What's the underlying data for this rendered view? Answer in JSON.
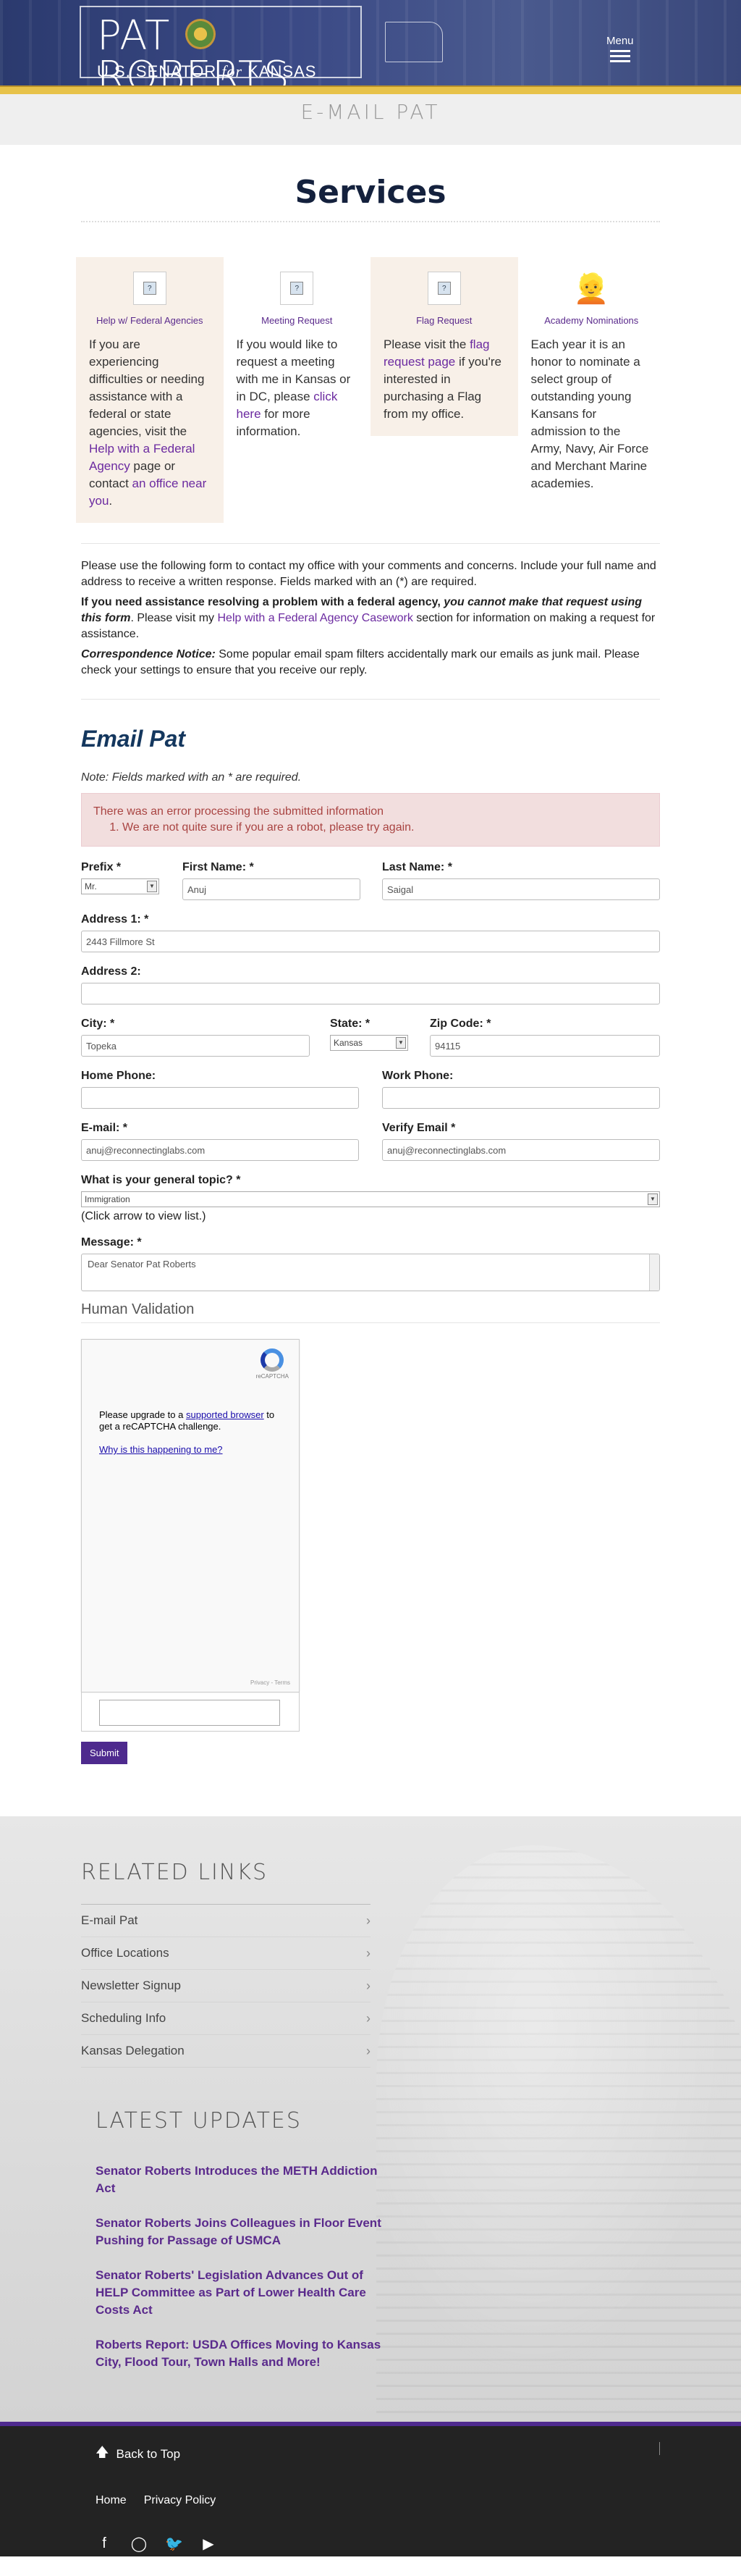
{
  "header": {
    "logo_name_left": "PAT",
    "logo_name_right": "ROBERTS",
    "logo_sub_left": "U.S. SENATOR",
    "logo_sub_for": "for",
    "logo_sub_right": "KANSAS",
    "menu_label": "Menu"
  },
  "page_heading": "E-MAIL PAT",
  "services": {
    "title": "Services",
    "cards": [
      {
        "title": "Help w/ Federal Agencies",
        "icon": "document-icon",
        "text_a": "If you are experiencing difficulties or needing assistance with a federal or state agencies, visit the ",
        "link_a": "Help with a Federal Agency",
        "text_b": " page or contact ",
        "link_b": "an office near you",
        "text_c": "."
      },
      {
        "title": "Meeting Request",
        "icon": "document-icon",
        "text_a": "If you would like to request a meeting with me in Kansas or in DC, please ",
        "link_a": "click here",
        "text_b": " for more information."
      },
      {
        "title": "Flag Request",
        "icon": "document-icon",
        "text_a": "Please visit the ",
        "link_a": "flag request page",
        "text_b": " if you're interested in purchasing a Flag from my office."
      },
      {
        "title": "Academy Nominations",
        "icon": "cadet-icon",
        "text_a": "Each year it is an honor to nominate a select group of outstanding young Kansans for admission to the Army, Navy, Air Force and Merchant Marine academies."
      }
    ]
  },
  "intro": {
    "p1": "Please use the following form to contact my office with your comments and concerns. Include your full name and address to receive a written response. Fields marked with an (*) are required.",
    "p2_bold": "If you need assistance resolving a problem with a federal agency, ",
    "p2_bold_italic": "you cannot make that request using this form",
    "p2_text": ". Please visit my ",
    "p2_link": "Help with a Federal Agency Casework",
    "p2_tail": " section for information on making a request for assistance.",
    "p3_label": "Correspondence Notice:",
    "p3_text": " Some popular email spam filters accidentally mark our emails as junk mail. Please check your settings to ensure that you receive our reply."
  },
  "form": {
    "title": "Email Pat",
    "note": "Note: Fields marked with an * are required.",
    "error_title": "There was an error processing the submitted information",
    "error_item": "We are not quite sure if you are a robot, please try again.",
    "prefix_label": "Prefix *",
    "prefix_value": "Mr.",
    "first_label": "First Name: *",
    "first_value": "Anuj",
    "last_label": "Last Name: *",
    "last_value": "Saigal",
    "addr1_label": "Address 1: *",
    "addr1_value": "2443 Fillmore St",
    "addr2_label": "Address 2:",
    "addr2_value": "",
    "city_label": "City: *",
    "city_value": "Topeka",
    "state_label": "State: *",
    "state_value": "Kansas",
    "zip_label": "Zip Code: *",
    "zip_value": "94115",
    "home_label": "Home Phone:",
    "work_label": "Work Phone:",
    "email_label": "E-mail: *",
    "email_value": "anuj@reconnectinglabs.com",
    "verify_label": "Verify Email *",
    "verify_value": "anuj@reconnectinglabs.com",
    "topic_label": "What is your general topic? *",
    "topic_value": "Immigration",
    "topic_hint": "(Click arrow to view list.)",
    "message_label": "Message: *",
    "message_value": "Dear Senator Pat Roberts",
    "human_label": "Human Validation",
    "captcha_logo": "reCAPTCHA",
    "captcha_msg_a": "Please upgrade to a ",
    "captcha_msg_link": "supported browser",
    "captcha_msg_b": " to get a reCAPTCHA challenge.",
    "captcha_why": "Why is this happening to me?",
    "captcha_terms": "Privacy - Terms",
    "submit_label": "Submit"
  },
  "related": {
    "title": "RELATED LINKS",
    "items": [
      "E-mail Pat",
      "Office Locations",
      "Newsletter Signup",
      "Scheduling Info",
      "Kansas Delegation"
    ],
    "updates_title": "LATEST UPDATES",
    "updates": [
      "Senator Roberts Introduces the METH Addiction Act",
      "Senator Roberts Joins Colleagues in Floor Event Pushing for Passage of USMCA",
      "Senator Roberts' Legislation Advances Out of HELP Committee as Part of Lower Health Care Costs Act",
      "Roberts Report: USDA Offices Moving to Kansas City, Flood Tour, Town Halls and More!"
    ]
  },
  "footer": {
    "back_top": "Back to Top",
    "links": [
      "Home",
      "Privacy Policy"
    ],
    "social": [
      "facebook-icon",
      "instagram-icon",
      "twitter-icon",
      "youtube-icon"
    ]
  },
  "colors": {
    "accent": "#4e2a8e",
    "navy": "#14213d",
    "gold": "#e7c24a",
    "error_bg": "#f2dede"
  }
}
